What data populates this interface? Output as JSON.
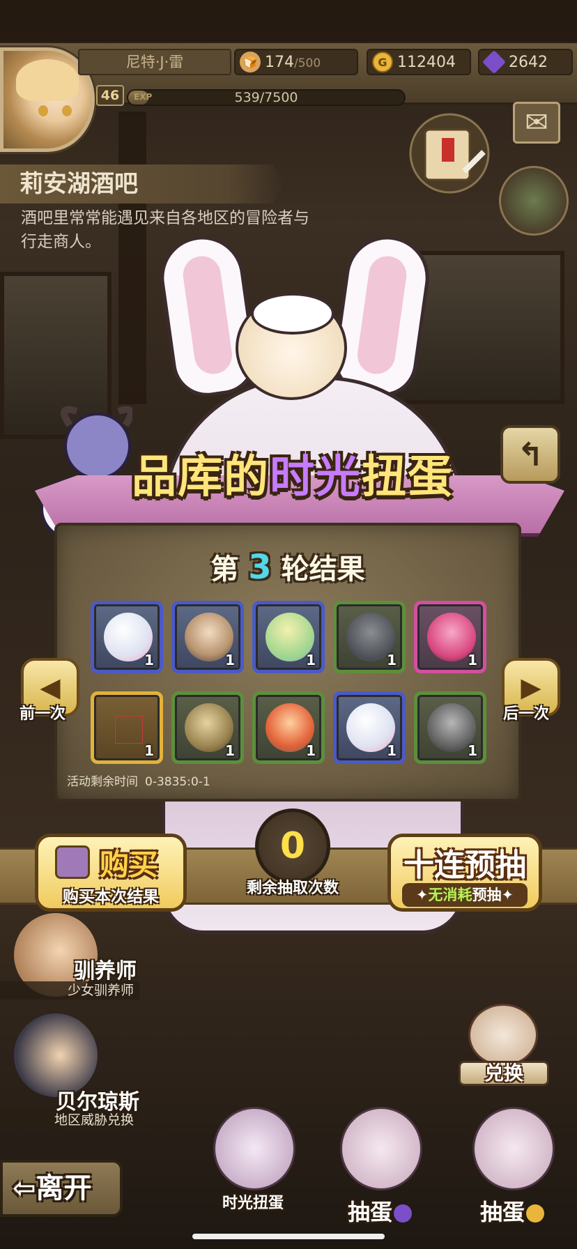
{
  "player": {
    "name": "尼特·J·雷",
    "level": "46",
    "exp_label": "EXP",
    "exp": "539/7500",
    "exp_fraction": 0.072
  },
  "resources": {
    "stamina_value": "174",
    "stamina_max": "/500",
    "gold": "112404",
    "gems": "2642"
  },
  "location": {
    "title": "莉安湖酒吧",
    "description": "酒吧里常常能遇见来自各地区的冒险者与行走商人。"
  },
  "event": {
    "title_part1": "品库的",
    "title_part2": "时光",
    "title_part3": "扭蛋",
    "round_prefix": "第",
    "round_number": "3",
    "round_suffix": "轮结果",
    "timer_label": "活动剩余时间",
    "timer_value": "0-3835:0-1",
    "prev_label": "前一次",
    "next_label": "后一次"
  },
  "results": [
    {
      "item": "white-pink-egg",
      "qty": "1",
      "rarity": "blue"
    },
    {
      "item": "fur-hat",
      "qty": "1",
      "rarity": "blue"
    },
    {
      "item": "green-striped-egg",
      "qty": "1",
      "rarity": "blue"
    },
    {
      "item": "turtle-shell",
      "qty": "1",
      "rarity": "green"
    },
    {
      "item": "thorn-egg",
      "qty": "1",
      "rarity": "pink"
    },
    {
      "item": "empty",
      "qty": "1",
      "rarity": "gold"
    },
    {
      "item": "wooden-egg",
      "qty": "1",
      "rarity": "green"
    },
    {
      "item": "fire-egg",
      "qty": "1",
      "rarity": "green"
    },
    {
      "item": "white-pink-egg",
      "qty": "1",
      "rarity": "blue"
    },
    {
      "item": "stone-golem",
      "qty": "1",
      "rarity": "green"
    }
  ],
  "actions": {
    "buy_title": "购买",
    "buy_sub": "购买本次结果",
    "draws_left": "0",
    "draws_label": "剩余抽取次数",
    "ten_title": "十连预抽",
    "ten_sub_a": "无消耗",
    "ten_sub_b": "预抽"
  },
  "npcs": [
    {
      "name": "驯养师",
      "role": "少女驯养师"
    },
    {
      "name": "贝尔琼斯",
      "role": "地区威胁兑换"
    }
  ],
  "bottom": {
    "leave": "离开",
    "exchange": "兑换",
    "time_gacha": "时光扭蛋",
    "draw1": "抽蛋",
    "draw2": "抽蛋"
  },
  "colors": {
    "accent_gold": "#ffe57a",
    "accent_purple": "#c67cff",
    "round_number": "#53d6e8",
    "draws_left": "#ffe04a"
  }
}
